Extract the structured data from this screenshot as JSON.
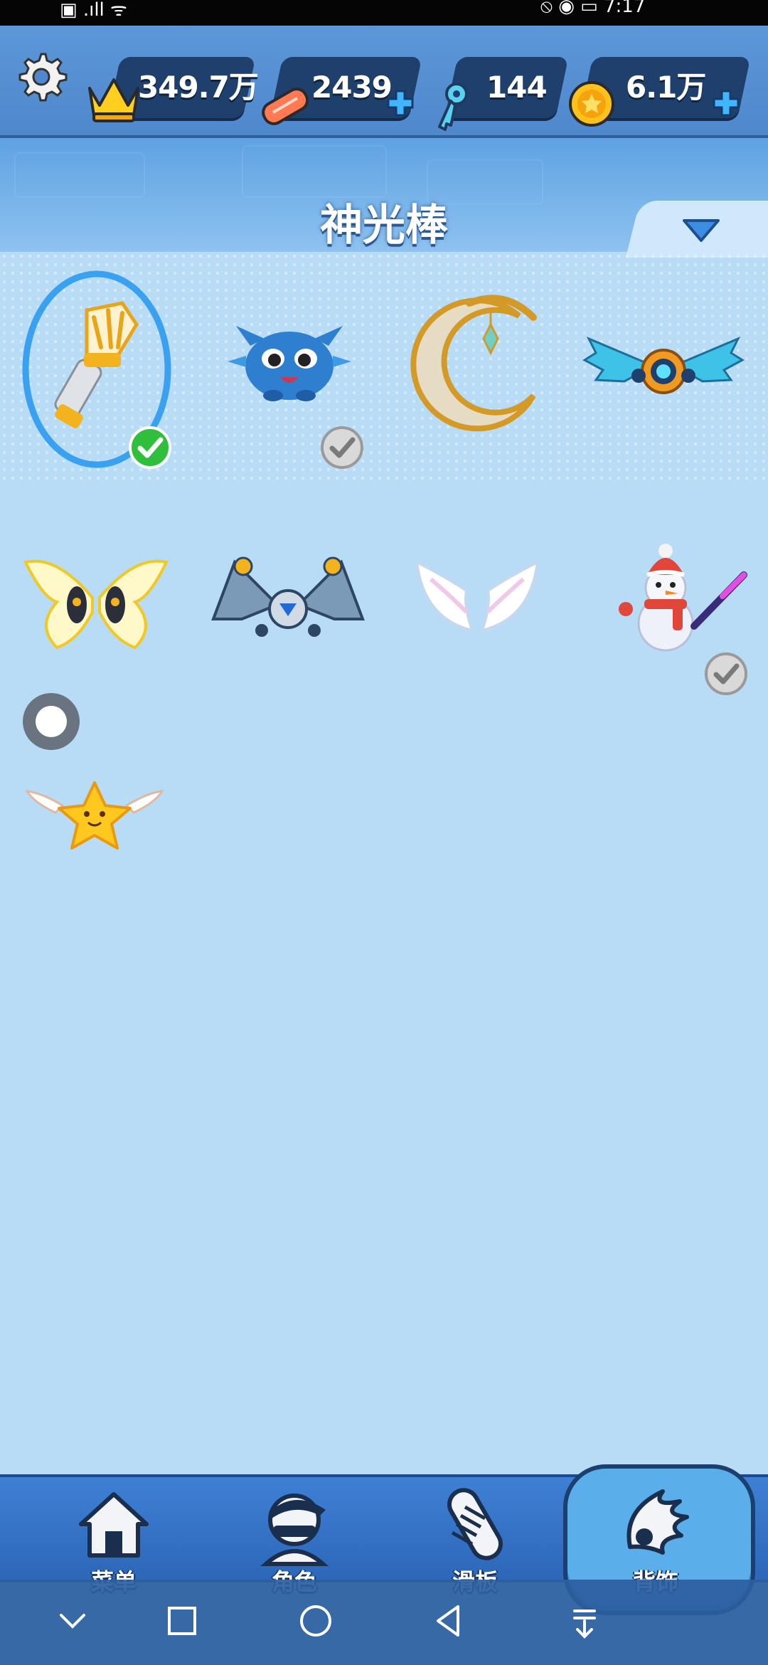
{
  "status_bar": {
    "left_text": "▣ .ıll ᯤ",
    "right_text": "⦸ ◉ ▭ 7:17"
  },
  "currencies": {
    "crown": {
      "value": "349.7万",
      "icon": "crown-icon"
    },
    "hoverboard": {
      "value": "2439",
      "icon": "hoverboard-ticket-icon",
      "has_plus": true
    },
    "key": {
      "value": "144",
      "icon": "key-icon"
    },
    "coin": {
      "value": "6.1万",
      "icon": "coin-icon",
      "has_plus": true
    }
  },
  "settings_icon": "gear-icon",
  "category_title": "神光棒",
  "dropdown_icon": "chevron-down-icon",
  "items": [
    {
      "name": "神光棒",
      "icon": "light-wand-icon",
      "selected": true,
      "status": "equipped-green-check"
    },
    {
      "name": "blue blob pet",
      "icon": "blue-blob-pet-icon",
      "status": "owned-grey-check"
    },
    {
      "name": "golden crescent",
      "icon": "golden-crescent-icon",
      "status": "none"
    },
    {
      "name": "mech blue wings",
      "icon": "mech-blue-wings-icon",
      "status": "none"
    },
    {
      "name": "butterfly wings",
      "icon": "butterfly-wings-icon",
      "status": "none"
    },
    {
      "name": "robot jet wings",
      "icon": "robot-jet-wings-icon",
      "status": "none"
    },
    {
      "name": "angel wings",
      "icon": "angel-wings-icon",
      "status": "none"
    },
    {
      "name": "snowman",
      "icon": "snowman-icon",
      "status": "owned-grey-check"
    },
    {
      "name": "winged star",
      "icon": "winged-star-icon",
      "status": "none"
    }
  ],
  "bottom_nav": [
    {
      "label": "菜单",
      "icon": "home-icon",
      "active": false
    },
    {
      "label": "角色",
      "icon": "character-icon",
      "active": false
    },
    {
      "label": "滑板",
      "icon": "skateboard-icon",
      "active": false
    },
    {
      "label": "背饰",
      "icon": "wing-icon",
      "active": true
    }
  ],
  "system_nav": [
    "chevron-down-icon",
    "square-icon",
    "circle-icon",
    "back-triangle-icon",
    "menu-down-icon"
  ],
  "colors": {
    "accent_blue": "#4f88cc",
    "check_green": "#2fbf3c",
    "bg": "#b8dcf6"
  }
}
